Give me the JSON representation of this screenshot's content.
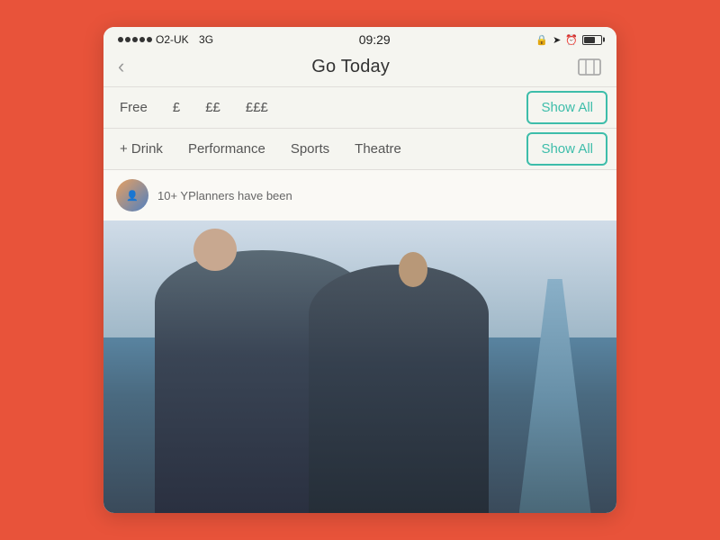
{
  "statusBar": {
    "carrier": "O2-UK",
    "network": "3G",
    "time": "09:29"
  },
  "navBar": {
    "title": "Go Today",
    "backLabel": "‹"
  },
  "priceFilters": {
    "items": [
      {
        "label": "Free",
        "id": "free"
      },
      {
        "label": "£",
        "id": "one-pound"
      },
      {
        "label": "££",
        "id": "two-pound"
      },
      {
        "label": "£££",
        "id": "three-pound"
      }
    ],
    "showAllLabel": "Show All"
  },
  "categoryFilters": {
    "items": [
      {
        "label": "+ Drink",
        "id": "drink"
      },
      {
        "label": "Performance",
        "id": "performance"
      },
      {
        "label": "Sports",
        "id": "sports"
      },
      {
        "label": "Theatre",
        "id": "theatre"
      }
    ],
    "showAllLabel": "Show All"
  },
  "yplanners": {
    "text": "10+ YPlanners have been",
    "avatarLabel": "YP"
  },
  "colors": {
    "accent": "#3dbdaa",
    "background": "#e8533a",
    "teal": "#3dbdaa"
  }
}
